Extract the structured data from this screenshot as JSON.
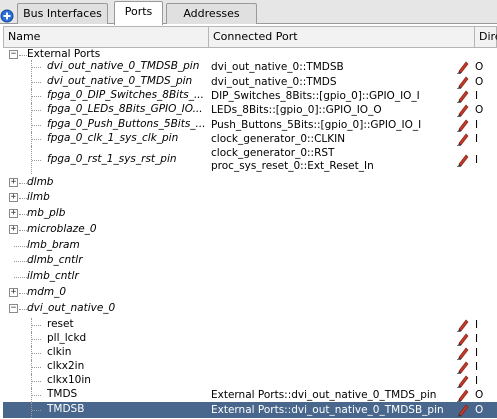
{
  "tabs": [
    {
      "label": "Bus Interfaces"
    },
    {
      "label": "Ports"
    },
    {
      "label": "Addresses"
    }
  ],
  "active_tab": "Ports",
  "columns": {
    "name": "Name",
    "connected_port": "Connected Port",
    "direction": "Dire"
  },
  "rows": [
    {
      "name": "External Ports",
      "italic": false,
      "toggle": "-",
      "indent": 0,
      "connected": [],
      "dir": "",
      "pencil": false
    },
    {
      "name": "dvi_out_native_0_TMDSB_pin",
      "italic": true,
      "toggle": "",
      "indent": 1,
      "connected": [
        "dvi_out_native_0::TMDSB"
      ],
      "dir": "O",
      "pencil": true
    },
    {
      "name": "dvi_out_native_0_TMDS_pin",
      "italic": true,
      "toggle": "",
      "indent": 1,
      "connected": [
        "dvi_out_native_0::TMDS"
      ],
      "dir": "O",
      "pencil": true
    },
    {
      "name": "fpga_0_DIP_Switches_8Bits_...",
      "italic": true,
      "toggle": "",
      "indent": 1,
      "connected": [
        "DIP_Switches_8Bits::[gpio_0]::GPIO_IO_I"
      ],
      "dir": "I",
      "pencil": true
    },
    {
      "name": "fpga_0_LEDs_8Bits_GPIO_IO...",
      "italic": true,
      "toggle": "",
      "indent": 1,
      "connected": [
        "LEDs_8Bits::[gpio_0]::GPIO_IO_O"
      ],
      "dir": "O",
      "pencil": true
    },
    {
      "name": "fpga_0_Push_Buttons_5Bits_...",
      "italic": true,
      "toggle": "",
      "indent": 1,
      "connected": [
        "Push_Buttons_5Bits::[gpio_0]::GPIO_IO_I"
      ],
      "dir": "I",
      "pencil": true
    },
    {
      "name": "fpga_0_clk_1_sys_clk_pin",
      "italic": true,
      "toggle": "",
      "indent": 1,
      "connected": [
        "clock_generator_0::CLKIN"
      ],
      "dir": "I",
      "pencil": true
    },
    {
      "name": "fpga_0_rst_1_sys_rst_pin",
      "italic": true,
      "toggle": "",
      "indent": 1,
      "connected": [
        "clock_generator_0::RST",
        "proc_sys_reset_0::Ext_Reset_In"
      ],
      "dir": "I",
      "pencil": true
    },
    {
      "name": "dlmb",
      "italic": true,
      "toggle": "+",
      "indent": 0,
      "connected": [],
      "dir": "",
      "pencil": false
    },
    {
      "name": "ilmb",
      "italic": true,
      "toggle": "+",
      "indent": 0,
      "connected": [],
      "dir": "",
      "pencil": false
    },
    {
      "name": "mb_plb",
      "italic": true,
      "toggle": "+",
      "indent": 0,
      "connected": [],
      "dir": "",
      "pencil": false
    },
    {
      "name": "microblaze_0",
      "italic": true,
      "toggle": "+",
      "indent": 0,
      "connected": [],
      "dir": "",
      "pencil": false
    },
    {
      "name": "lmb_bram",
      "italic": true,
      "toggle": "",
      "indent": 0,
      "connected": [],
      "dir": "",
      "pencil": false
    },
    {
      "name": "dlmb_cntlr",
      "italic": true,
      "toggle": "",
      "indent": 0,
      "connected": [],
      "dir": "",
      "pencil": false
    },
    {
      "name": "ilmb_cntlr",
      "italic": true,
      "toggle": "",
      "indent": 0,
      "connected": [],
      "dir": "",
      "pencil": false
    },
    {
      "name": "mdm_0",
      "italic": true,
      "toggle": "+",
      "indent": 0,
      "connected": [],
      "dir": "",
      "pencil": false
    },
    {
      "name": "dvi_out_native_0",
      "italic": true,
      "toggle": "-",
      "indent": 0,
      "connected": [],
      "dir": "",
      "pencil": false
    },
    {
      "name": "reset",
      "italic": false,
      "toggle": "",
      "indent": 1,
      "connected": [],
      "dir": "I",
      "pencil": true
    },
    {
      "name": "pll_lckd",
      "italic": false,
      "toggle": "",
      "indent": 1,
      "connected": [],
      "dir": "I",
      "pencil": true
    },
    {
      "name": "clkin",
      "italic": false,
      "toggle": "",
      "indent": 1,
      "connected": [],
      "dir": "I",
      "pencil": true
    },
    {
      "name": "clkx2in",
      "italic": false,
      "toggle": "",
      "indent": 1,
      "connected": [],
      "dir": "I",
      "pencil": true
    },
    {
      "name": "clkx10in",
      "italic": false,
      "toggle": "",
      "indent": 1,
      "connected": [],
      "dir": "I",
      "pencil": true
    },
    {
      "name": "TMDS",
      "italic": false,
      "toggle": "",
      "indent": 1,
      "connected": [
        "External Ports::dvi_out_native_0_TMDS_pin"
      ],
      "dir": "O",
      "pencil": true
    },
    {
      "name": "TMDSB",
      "italic": false,
      "toggle": "",
      "indent": 1,
      "connected": [
        "External Ports::dvi_out_native_0_TMDSB_pin"
      ],
      "dir": "O",
      "pencil": true,
      "selected": true
    }
  ],
  "colors": {
    "selection": "#49678c",
    "pencil": "#c0392b"
  }
}
